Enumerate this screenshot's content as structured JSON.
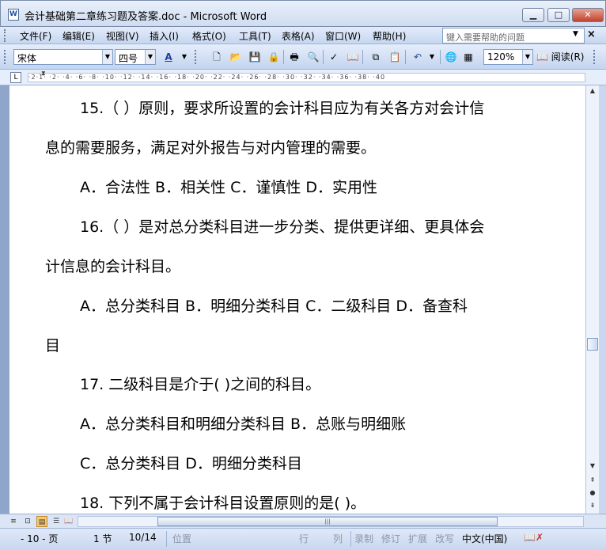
{
  "window": {
    "title": "会计基础第二章练习题及答案.doc - Microsoft Word",
    "controls": {
      "minimize": "▁",
      "maximize": "□",
      "close": "✕"
    }
  },
  "menubar": {
    "items": [
      "文件(F)",
      "编辑(E)",
      "视图(V)",
      "插入(I)",
      "格式(O)",
      "工具(T)",
      "表格(A)",
      "窗口(W)",
      "帮助(H)"
    ],
    "help_placeholder": "键入需要帮助的问题",
    "close_doc": "×"
  },
  "toolbar": {
    "font": "宋体",
    "size": "四号",
    "zoom": "120%",
    "read_label": "阅读(R)",
    "icons": [
      "new-icon",
      "open-icon",
      "save-icon",
      "permission-icon",
      "print-icon",
      "print-preview-icon",
      "spelling-icon",
      "research-icon",
      "copy-icon",
      "paste-icon",
      "undo-icon",
      "hyperlink-icon",
      "table-icon"
    ]
  },
  "ruler": {
    "ticks": "·2·1· ·2· ·4· ·6· ·8· ·10· ·12· ·14· ·16· ·18· ·20· ·22· ·24· ·26· ·28· ·30· ·32· ·34· ·36· ·38· ·40"
  },
  "document": {
    "lines": [
      "15.（    ）原则，要求所设置的会计科目应为有关各方对会计信",
      "息的需要服务，满足对外报告与对内管理的需要。",
      "A．合法性    B．相关性     C．谨慎性     D．实用性",
      "16.（    ）是对总分类科目进一步分类、提供更详细、更具体会",
      "计信息的会计科目。",
      "A．总分类科目  B．明细分类科目  C．二级科目     D．备查科",
      "目",
      "17. 二级科目是介于(    )之间的科目。",
      "A．总分类科目和明细分类科目     B．总账与明细账",
      "C．总分类科目                  D．明细分类科目",
      "18. 下列不属于会计科目设置原则的是(    )。"
    ]
  },
  "statusbar": {
    "page": "- 10 - 页",
    "section": "1 节",
    "pages": "10/14",
    "position": "位置",
    "line": "行",
    "column": "列",
    "rec": "录制",
    "trk": "修订",
    "ext": "扩展",
    "ovr": "改写",
    "language": "中文(中国)"
  }
}
